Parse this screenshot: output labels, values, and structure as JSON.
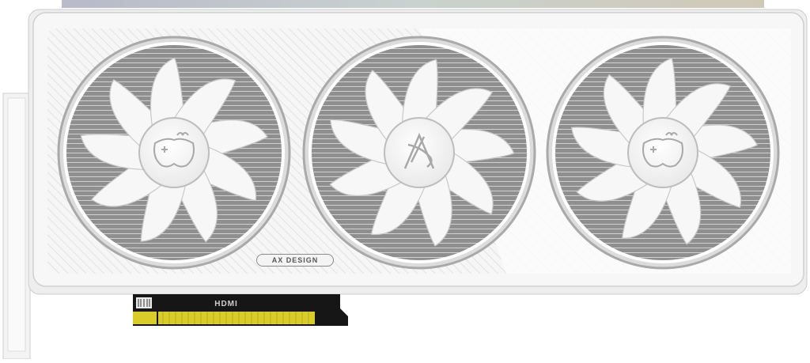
{
  "product": {
    "design_label": "AX DESIGN",
    "port_label": "HDMI"
  },
  "fans": [
    {
      "logo_icon": "gamepad-fist-icon"
    },
    {
      "logo_icon": "ax-logo-icon"
    },
    {
      "logo_icon": "gamepad-fist-icon"
    }
  ],
  "colors": {
    "shroud": "#f5f5f5",
    "edge_gold": "#d9cc2a",
    "pcb": "#161616",
    "heatsink": "#9a9a9a"
  }
}
